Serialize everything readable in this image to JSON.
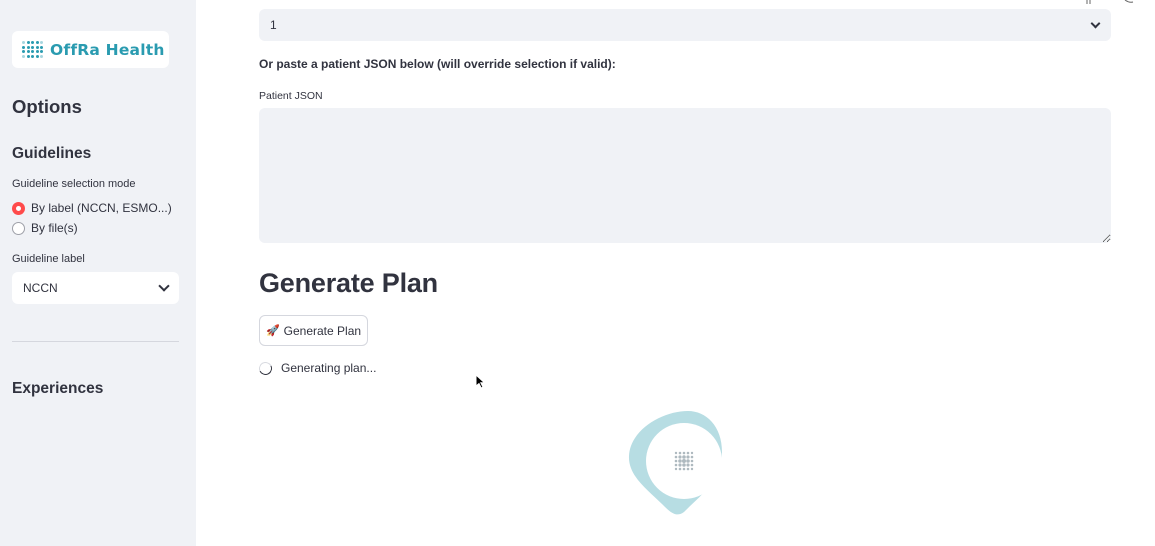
{
  "sidebar": {
    "logo": {
      "text": "OffRa Health",
      "icon": "dots-grid-logo-icon"
    },
    "options_title": "Options",
    "guidelines_title": "Guidelines",
    "mode_label": "Guideline selection mode",
    "mode_options": [
      {
        "label": "By label (NCCN, ESMO...)",
        "selected": true
      },
      {
        "label": "By file(s)",
        "selected": false
      }
    ],
    "label_label": "Guideline label",
    "label_value": "NCCN",
    "experiences_title": "Experiences"
  },
  "main": {
    "patient_select_value": "1",
    "paste_instruction": "Or paste a patient JSON below (will override selection if valid):",
    "json_label": "Patient JSON",
    "json_value": "",
    "section_title": "Generate Plan",
    "generate_button": {
      "icon": "🚀",
      "label": "Generate Plan"
    },
    "status_text": "Generating plan..."
  },
  "colors": {
    "accent": "#ff4b4b",
    "brand": "#2a9bb0",
    "sidebar_bg": "#f0f2f6",
    "loader_blob": "#b7dde3"
  }
}
